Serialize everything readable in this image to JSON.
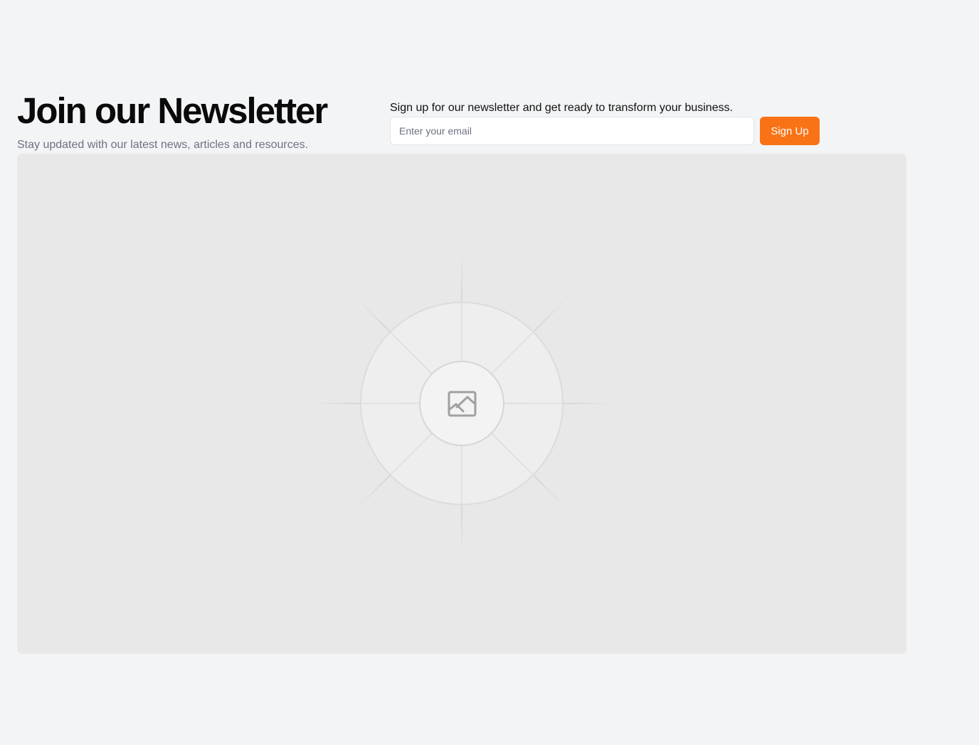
{
  "newsletter": {
    "title": "Join our Newsletter",
    "subtitle": "Stay updated with our latest news, articles and resources.",
    "form_intro": "Sign up for our newsletter and get ready to transform your business.",
    "email_placeholder": "Enter your email",
    "email_value": "",
    "submit_label": "Sign Up"
  },
  "media": {
    "icon": "image-icon"
  },
  "colors": {
    "background": "#f3f4f6",
    "accent": "#f97316",
    "heading": "#0a0a0a",
    "muted_text": "#6b7280",
    "placeholder_bg": "#e8e8e8"
  }
}
